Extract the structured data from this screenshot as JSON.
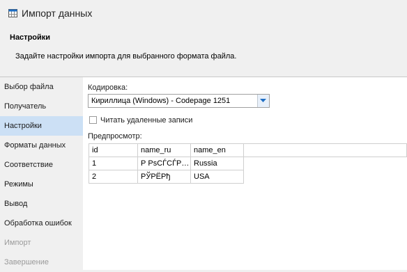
{
  "window": {
    "title": "Импорт данных",
    "icon": "calendar-table-icon"
  },
  "header": {
    "title": "Настройки",
    "description": "Задайте настройки импорта для выбранного формата файла."
  },
  "sidebar": {
    "items": [
      {
        "label": "Выбор файла",
        "state": "normal"
      },
      {
        "label": "Получатель",
        "state": "normal"
      },
      {
        "label": "Настройки",
        "state": "active"
      },
      {
        "label": "Форматы данных",
        "state": "normal"
      },
      {
        "label": "Соответствие",
        "state": "normal"
      },
      {
        "label": "Режимы",
        "state": "normal"
      },
      {
        "label": "Вывод",
        "state": "normal"
      },
      {
        "label": "Обработка ошибок",
        "state": "normal"
      },
      {
        "label": "Импорт",
        "state": "disabled"
      },
      {
        "label": "Завершение",
        "state": "disabled"
      }
    ]
  },
  "main": {
    "encoding_label": "Кодировка:",
    "encoding_value": "Кириллица (Windows) - Codepage 1251",
    "read_deleted_label": "Читать удаленные записи",
    "read_deleted_checked": false,
    "preview_label": "Предпросмотр:",
    "preview": {
      "columns": [
        "id",
        "name_ru",
        "name_en"
      ],
      "rows": [
        [
          "1",
          "Р РѕСЃСЃРё...",
          "Russia"
        ],
        [
          "2",
          "РЎРЁРђ",
          "USA"
        ]
      ]
    }
  },
  "colors": {
    "active_nav_bg": "#cce0f5",
    "disabled_text": "#9a9a9a",
    "combo_button": "#e8f0fa",
    "icon_blue": "#1f6fc5"
  }
}
